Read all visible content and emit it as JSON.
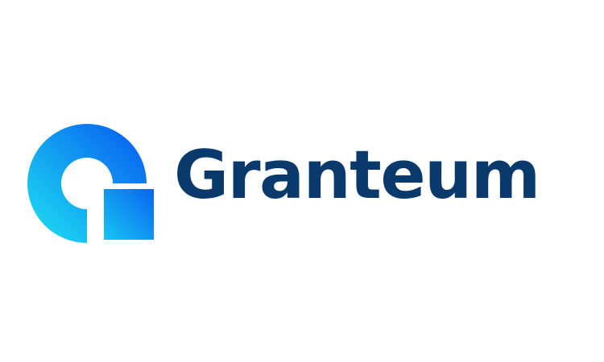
{
  "brand": {
    "name": "Granteum",
    "text_color": "#0a3a6b",
    "gradient_start": "#1ee4f2",
    "gradient_end": "#0657f0"
  },
  "logo_mark": {
    "icon": "ring-with-square-icon"
  }
}
